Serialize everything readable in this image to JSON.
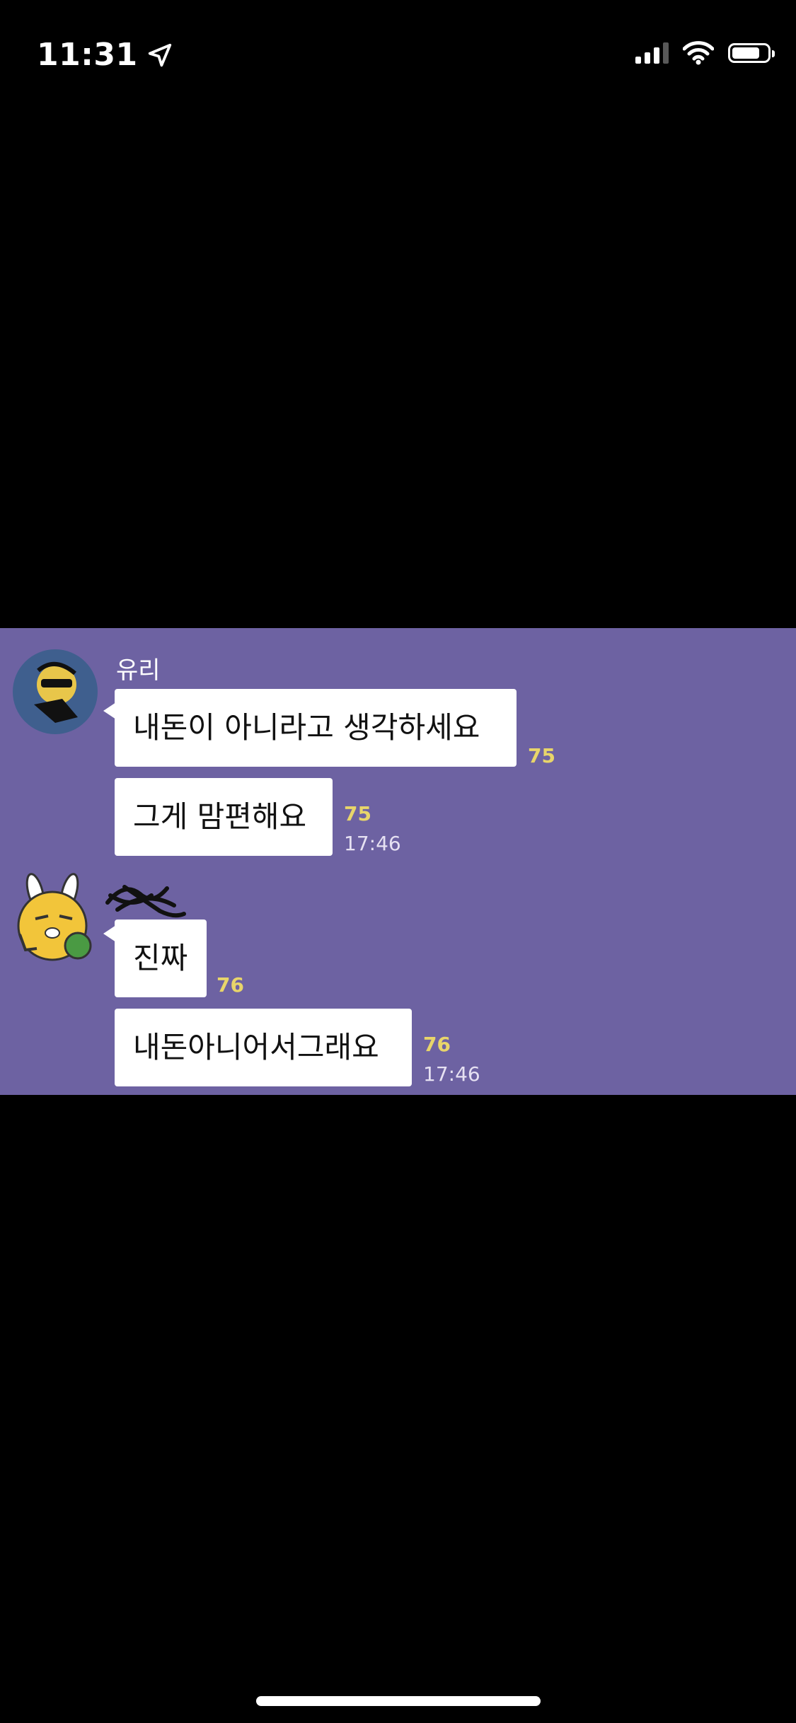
{
  "status_bar": {
    "time": "11:31"
  },
  "chat": {
    "colors": {
      "background": "#6d62a2",
      "bubble": "#ffffff",
      "unread": "#e8d56a"
    },
    "group1": {
      "sender": "유리",
      "messages": [
        {
          "text": "내돈이 아니라고 생각하세요",
          "unread": "75"
        },
        {
          "text": "그게 맘편해요",
          "unread": "75",
          "time": "17:46"
        }
      ]
    },
    "group2": {
      "messages": [
        {
          "text": "진짜",
          "unread": "76"
        },
        {
          "text": "내돈아니어서그래요",
          "unread": "76",
          "time": "17:46"
        }
      ]
    }
  }
}
